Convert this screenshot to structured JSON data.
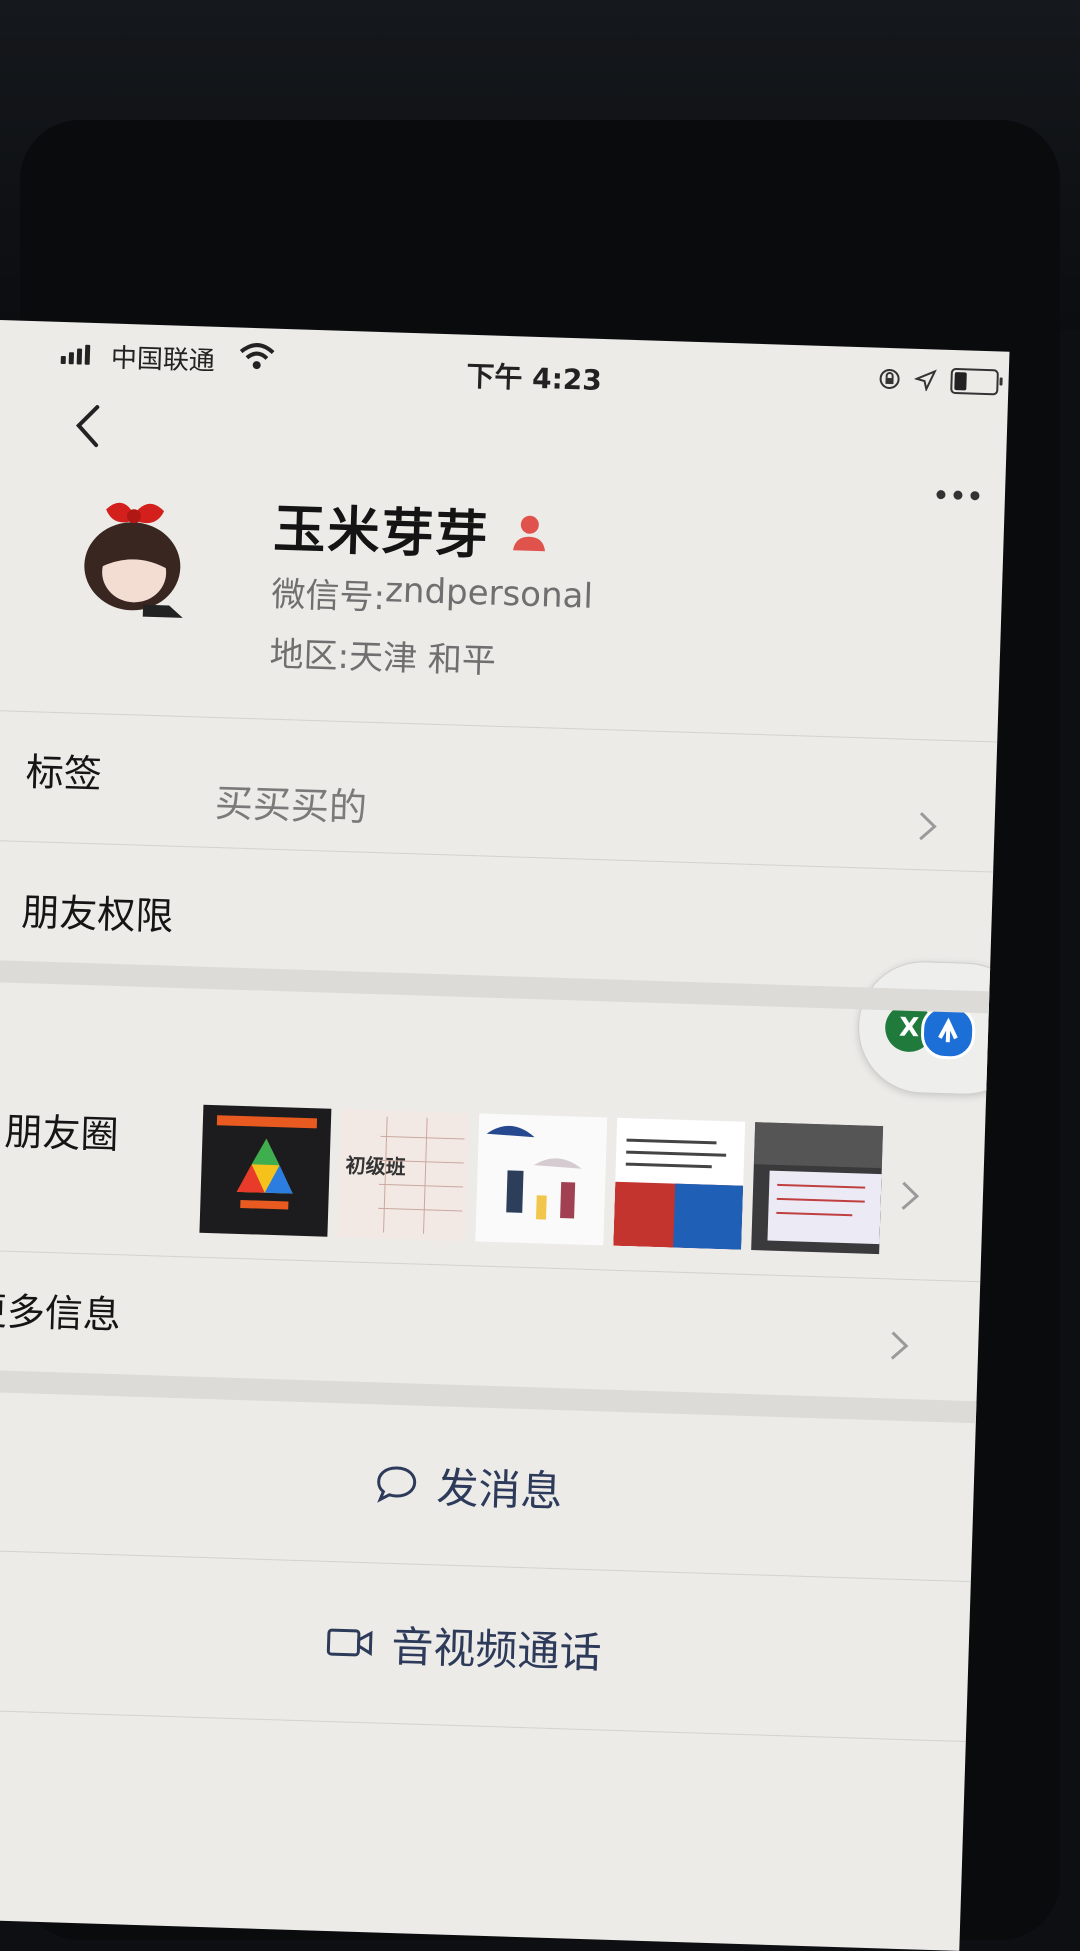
{
  "status_bar": {
    "carrier": "中国联通",
    "time": "下午 4:23"
  },
  "profile": {
    "name": "玉米芽芽",
    "wechat_id_label": "微信号:",
    "wechat_id": "zndpersonal",
    "region_label": "地区:",
    "region": "天津 和平"
  },
  "rows": {
    "tags_label": "标签",
    "tags_value": "买买买的",
    "permissions_label": "朋友权限",
    "moments_label": "朋友圈",
    "more_info_label": "更多信息"
  },
  "moments_thumbnails": {
    "thumb2_text": "初级班"
  },
  "actions": {
    "send_message": "发消息",
    "video_call": "音视频通话"
  },
  "floating_pill": {
    "icon_a_letter": "X"
  },
  "colors": {
    "background": "#ecebe8",
    "action_text": "#2d3a5a",
    "gender_icon": "#e0524c"
  },
  "icons": [
    "back-arrow-icon",
    "more-dots-icon",
    "wifi-icon",
    "signal-icon",
    "battery-icon",
    "location-icon",
    "lock-rotation-icon",
    "gender-icon",
    "chevron-right-icon",
    "chat-bubble-icon",
    "video-camera-icon"
  ]
}
